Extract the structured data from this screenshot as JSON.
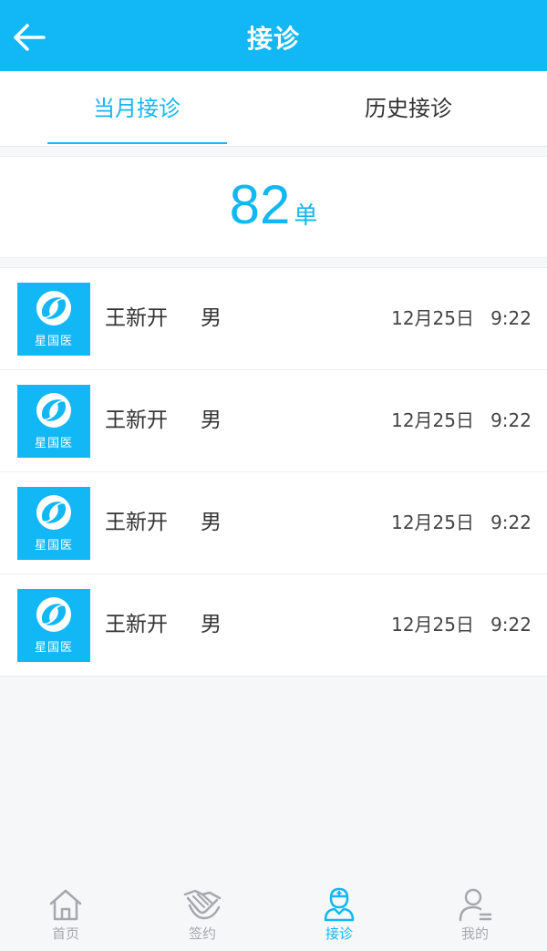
{
  "header": {
    "title": "接诊",
    "back_icon": "arrow-left-icon"
  },
  "tabs": [
    {
      "label": "当月接诊",
      "active": true
    },
    {
      "label": "历史接诊",
      "active": false
    }
  ],
  "summary": {
    "count": "82",
    "unit": "单"
  },
  "records": [
    {
      "avatar_text": "星国医",
      "name": "王新开",
      "gender": "男",
      "date": "12月25日",
      "time": "9:22"
    },
    {
      "avatar_text": "星国医",
      "name": "王新开",
      "gender": "男",
      "date": "12月25日",
      "time": "9:22"
    },
    {
      "avatar_text": "星国医",
      "name": "王新开",
      "gender": "男",
      "date": "12月25日",
      "time": "9:22"
    },
    {
      "avatar_text": "星国医",
      "name": "王新开",
      "gender": "男",
      "date": "12月25日",
      "time": "9:22"
    }
  ],
  "bottom_nav": [
    {
      "label": "首页",
      "icon": "home-icon",
      "active": false
    },
    {
      "label": "签约",
      "icon": "handshake-icon",
      "active": false
    },
    {
      "label": "接诊",
      "icon": "doctor-icon",
      "active": true
    },
    {
      "label": "我的",
      "icon": "user-icon",
      "active": false
    }
  ],
  "colors": {
    "accent": "#12b7f5",
    "nav_inactive": "#a5a8ad",
    "text": "#333333"
  }
}
